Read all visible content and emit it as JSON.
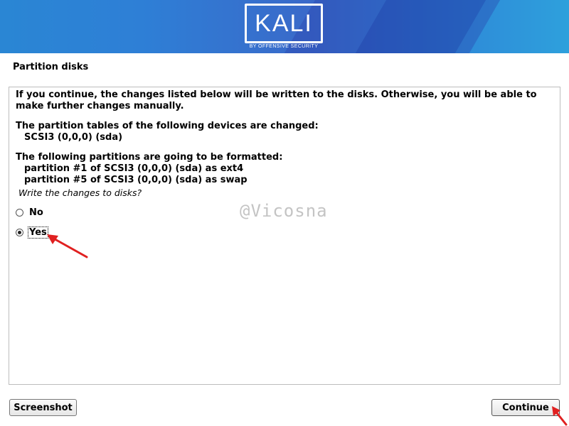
{
  "banner": {
    "logo_text": "KALI",
    "logo_subtitle": "BY OFFENSIVE SECURITY"
  },
  "page_title": "Partition disks",
  "content": {
    "intro": "If you continue, the changes listed below will be written to the disks. Otherwise, you will be able to make further changes manually.",
    "tables_heading": "The partition tables of the following devices are changed:",
    "tables_items": [
      "SCSI3 (0,0,0) (sda)"
    ],
    "format_heading": "The following partitions are going to be formatted:",
    "format_items": [
      "partition #1 of SCSI3 (0,0,0) (sda) as ext4",
      "partition #5 of SCSI3 (0,0,0) (sda) as swap"
    ],
    "question": "Write the changes to disks?",
    "options": [
      {
        "label": "No",
        "selected": false
      },
      {
        "label": "Yes",
        "selected": true
      }
    ]
  },
  "watermark": "@Vicosna",
  "buttons": {
    "screenshot": "Screenshot",
    "continue": "Continue"
  },
  "colors": {
    "banner_start": "#2a86d4",
    "banner_end": "#2ea0dc",
    "annotation_arrow": "#e02020"
  }
}
